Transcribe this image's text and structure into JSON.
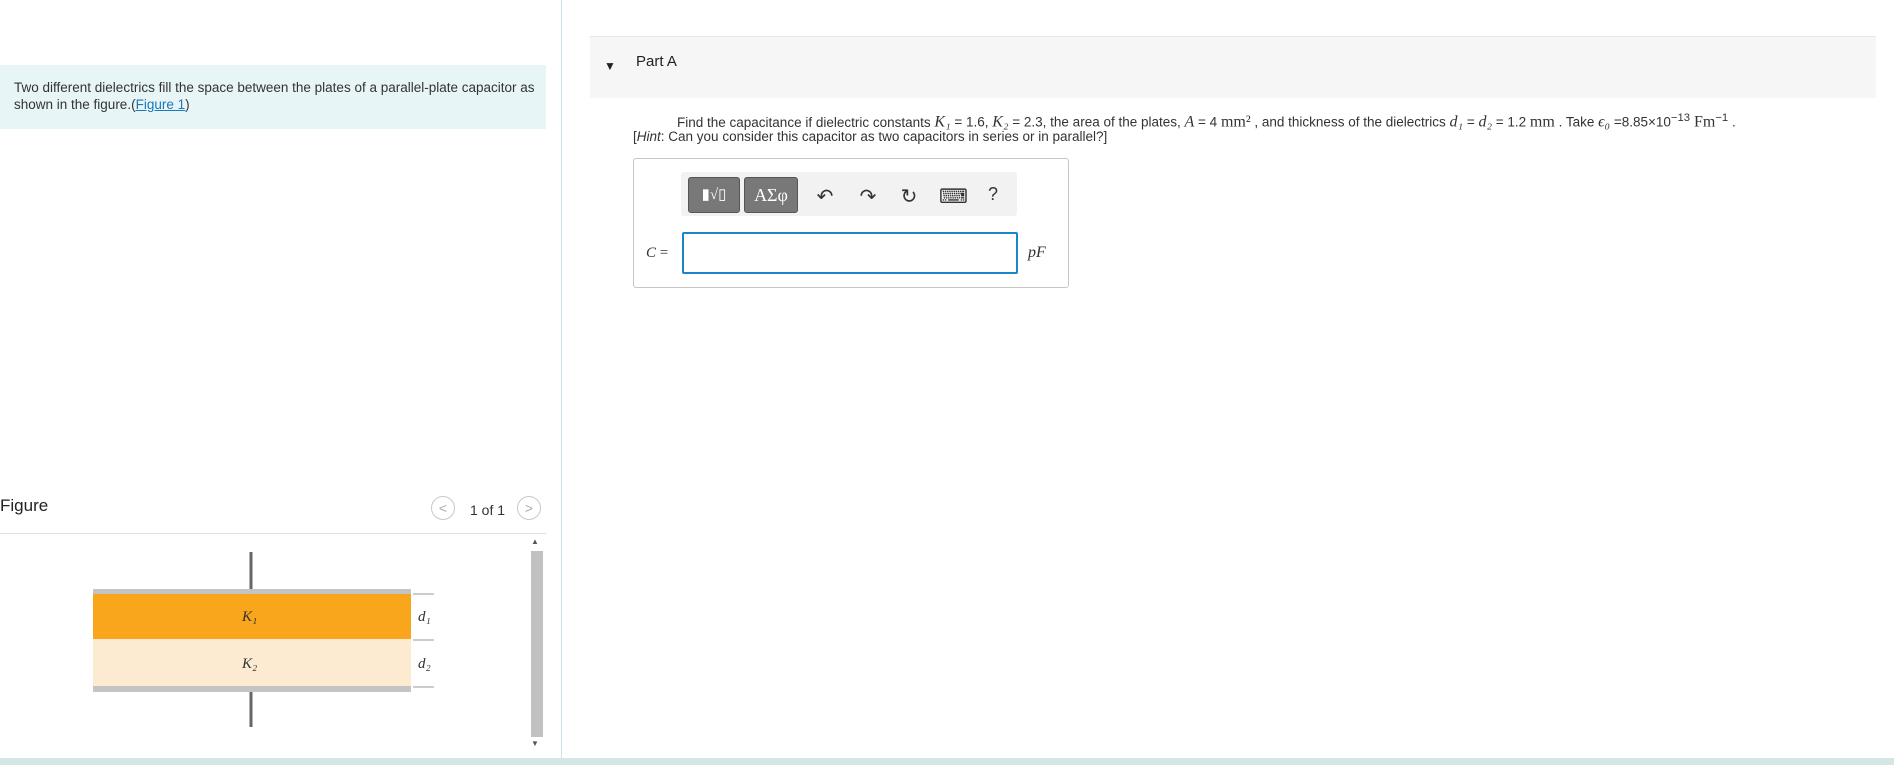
{
  "intro": {
    "text": "Two different dielectrics fill the space between the plates of a parallel-plate capacitor as shown in the figure.",
    "open_paren": "(",
    "figure_link": "Figure 1",
    "close_paren": ")"
  },
  "figure": {
    "title": "Figure",
    "counter": "1 of 1",
    "prev_symbol": "<",
    "next_symbol": ">",
    "labels": {
      "k1": "K₁",
      "k2": "K₂",
      "d1": "d₁",
      "d2": "d₂"
    },
    "colors": {
      "k1_fill": "#f9a61c",
      "k2_fill": "#fdebd1",
      "plate": "#c4c4c4",
      "lead": "#666666"
    }
  },
  "part": {
    "caret": "▼",
    "title": "Part A"
  },
  "question": {
    "t1": "Find the capacitance if dielectric constants ",
    "K1": "K₁",
    "t2": " = 1.6, ",
    "K2": "K₂",
    "t3": " = 2.3, the area of the plates, ",
    "A": "A",
    "t4": " = 4 ",
    "A_unit": "mm²",
    "t5": " , and thickness of the dielectrics ",
    "d1": "d₁",
    "t6": " = ",
    "d2": "d₂",
    "t7": " = 1.2 ",
    "d_unit": "mm",
    "t8": " . Take ",
    "eps": "ϵ₀",
    "t9": " =8.85×10",
    "exp": "−13",
    "eps_unit": " Fm",
    "eps_exp": "−1",
    "t10": " .",
    "hint_open": "[",
    "hint_label": "Hint",
    "hint_text": ": Can you consider this capacitor as two capacitors in series or in parallel?]"
  },
  "answer": {
    "toolbar": {
      "templates_label": "▮√▯",
      "symbols_label": "ΑΣφ",
      "undo_icon": "↶",
      "redo_icon": "↷",
      "reset_icon": "↻",
      "keyboard_icon": "⌨",
      "help_label": "?"
    },
    "variable": "C",
    "equals": " =",
    "value": "",
    "unit": "pF"
  },
  "theme": {
    "accent": "#1a86c8",
    "intro_bg": "#e8f5f7",
    "link": "#1a77b8"
  }
}
